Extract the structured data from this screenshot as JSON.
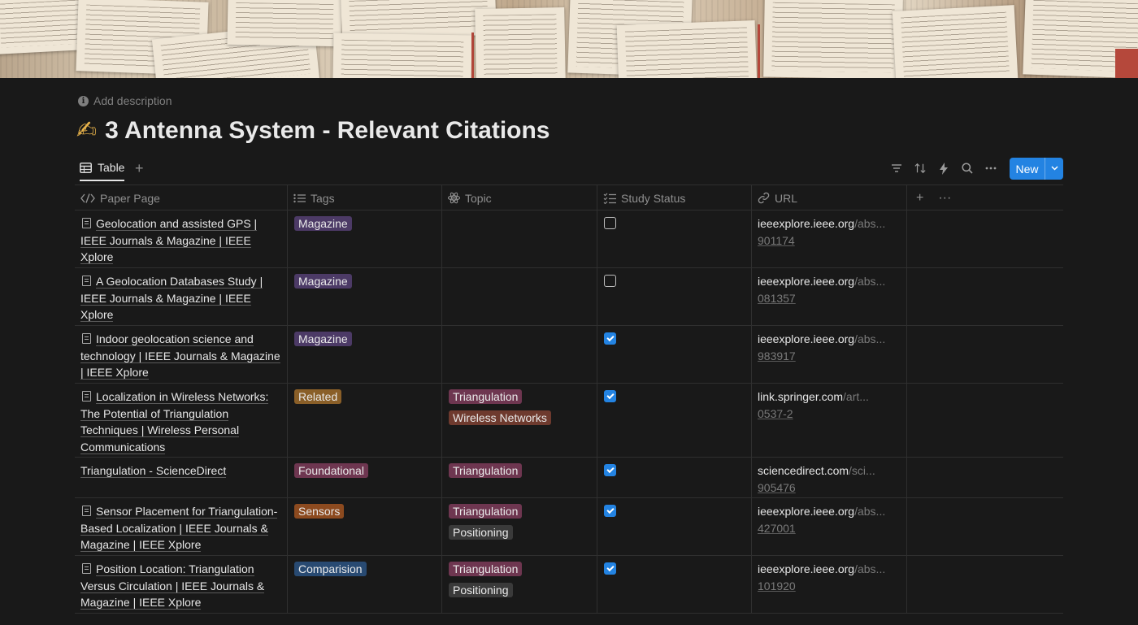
{
  "description_placeholder": "Add description",
  "title": {
    "emoji": "✍",
    "text": "3 Antenna System - Relevant Citations"
  },
  "view": {
    "tab_label": "Table",
    "add_view": "+",
    "new_button": "New"
  },
  "columns": {
    "paper_page": "Paper Page",
    "tags": "Tags",
    "topic": "Topic",
    "study_status": "Study Status",
    "url": "URL",
    "add": "+",
    "more": "···"
  },
  "colors": {
    "Magazine": "#4c3a66",
    "Related": "#8a5f28",
    "Foundational": "#6e3650",
    "Sensors": "#8c4a1f",
    "Comparision": "#284a72",
    "Triangulation": "#6e3650",
    "Wireless Networks": "#6e3a2e",
    "Positioning": "#3a3a3a",
    "accent": "#2383e2"
  },
  "rows": [
    {
      "paper": "Geolocation and assisted GPS | IEEE Journals & Magazine | IEEE Xplore",
      "has_doc_icon": true,
      "tag": "Magazine",
      "topics": [],
      "checked": false,
      "url_domain": "ieeexplore.ieee.org",
      "url_path": "/abs...",
      "url_tail": "901174"
    },
    {
      "paper": "A Geolocation Databases Study | IEEE Journals & Magazine | IEEE Xplore",
      "has_doc_icon": true,
      "tag": "Magazine",
      "topics": [],
      "checked": false,
      "url_domain": "ieeexplore.ieee.org",
      "url_path": "/abs...",
      "url_tail": "081357"
    },
    {
      "paper": "Indoor geolocation science and technology | IEEE Journals & Magazine | IEEE Xplore",
      "has_doc_icon": true,
      "tag": "Magazine",
      "topics": [],
      "checked": true,
      "url_domain": "ieeexplore.ieee.org",
      "url_path": "/abs...",
      "url_tail": "983917"
    },
    {
      "paper": "Localization in Wireless Networks: The Potential of Triangulation Techniques | Wireless Personal Communications",
      "has_doc_icon": true,
      "tag": "Related",
      "topics": [
        "Triangulation",
        "Wireless Networks"
      ],
      "checked": true,
      "url_domain": "link.springer.com",
      "url_path": "/art...",
      "url_tail": "0537-2"
    },
    {
      "paper": "Triangulation - ScienceDirect",
      "has_doc_icon": false,
      "tag": "Foundational",
      "topics": [
        "Triangulation"
      ],
      "checked": true,
      "url_domain": "sciencedirect.com",
      "url_path": "/sci...",
      "url_tail": "905476"
    },
    {
      "paper": "Sensor Placement for Triangulation-Based Localization | IEEE Journals & Magazine | IEEE Xplore",
      "has_doc_icon": true,
      "tag": "Sensors",
      "topics": [
        "Triangulation",
        "Positioning"
      ],
      "checked": true,
      "url_domain": "ieeexplore.ieee.org",
      "url_path": "/abs...",
      "url_tail": "427001"
    },
    {
      "paper": "Position Location: Triangulation Versus Circulation | IEEE Journals & Magazine | IEEE Xplore",
      "has_doc_icon": true,
      "tag": "Comparision",
      "topics": [
        "Triangulation",
        "Positioning"
      ],
      "checked": true,
      "url_domain": "ieeexplore.ieee.org",
      "url_path": "/abs...",
      "url_tail": "101920"
    }
  ]
}
